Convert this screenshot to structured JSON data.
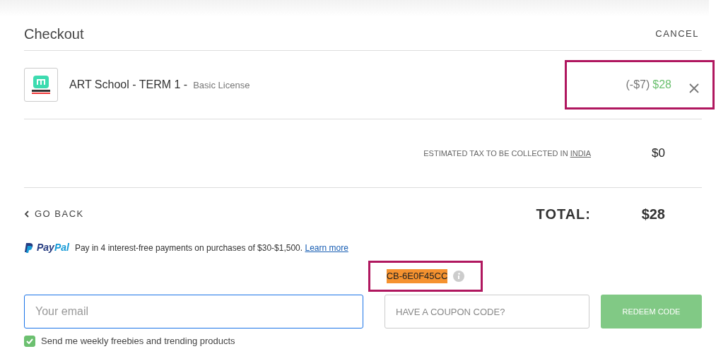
{
  "header": {
    "title": "Checkout",
    "cancel": "CANCEL"
  },
  "item": {
    "title": "ART School - TERM 1 -",
    "license": "Basic License",
    "discount": "(-$7)",
    "price": "$28",
    "highlighted": true
  },
  "tax": {
    "label": "ESTIMATED TAX TO BE COLLECTED IN",
    "country": "INDIA",
    "amount": "$0"
  },
  "back": "GO BACK",
  "total": {
    "label": "TOTAL:",
    "amount": "$28"
  },
  "paypal": {
    "brand_pay": "Pay",
    "brand_pal": "Pal",
    "message": "Pay in 4 interest-free payments on purchases of $30-$1,500.",
    "link": "Learn more"
  },
  "coupon": {
    "code": "CB-6E0F45CC",
    "highlighted": true
  },
  "email": {
    "placeholder": "Your email"
  },
  "coupon_field": {
    "placeholder": "HAVE A COUPON CODE?"
  },
  "redeem": {
    "label": "REDEEM CODE",
    "disabled": true
  },
  "newsletter": {
    "label": "Send me weekly freebies and trending products",
    "checked": true
  }
}
